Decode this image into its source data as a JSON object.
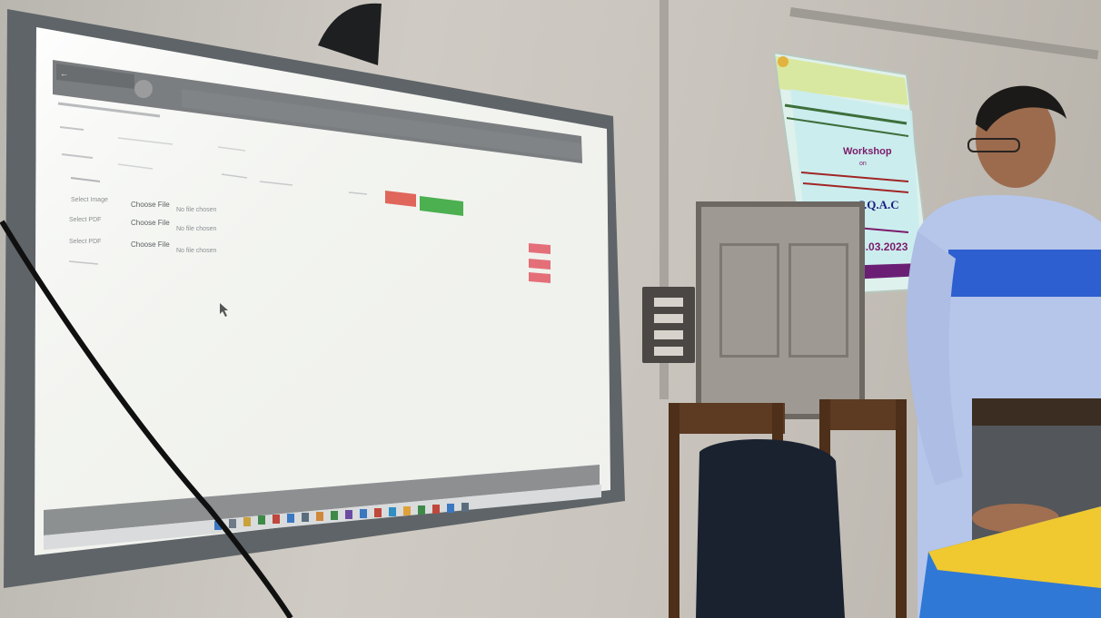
{
  "screen": {
    "rows": [
      {
        "label": "Select Image",
        "button": "Choose File",
        "status": "No file chosen"
      },
      {
        "label": "Select PDF",
        "button": "Choose File",
        "status": "No file chosen"
      },
      {
        "label": "Select PDF",
        "button": "Choose File",
        "status": "No file chosen"
      }
    ],
    "colors": {
      "header_bar": "#7d7f80",
      "red_button": "#e0665c",
      "green_button": "#4caf50",
      "pink_button": "#e46f79"
    }
  },
  "banner": {
    "line_workshop": "Workshop",
    "line_on": "on",
    "line_iqac": "I.Q.A.C",
    "line_date": "Date: 13.03.2023"
  }
}
